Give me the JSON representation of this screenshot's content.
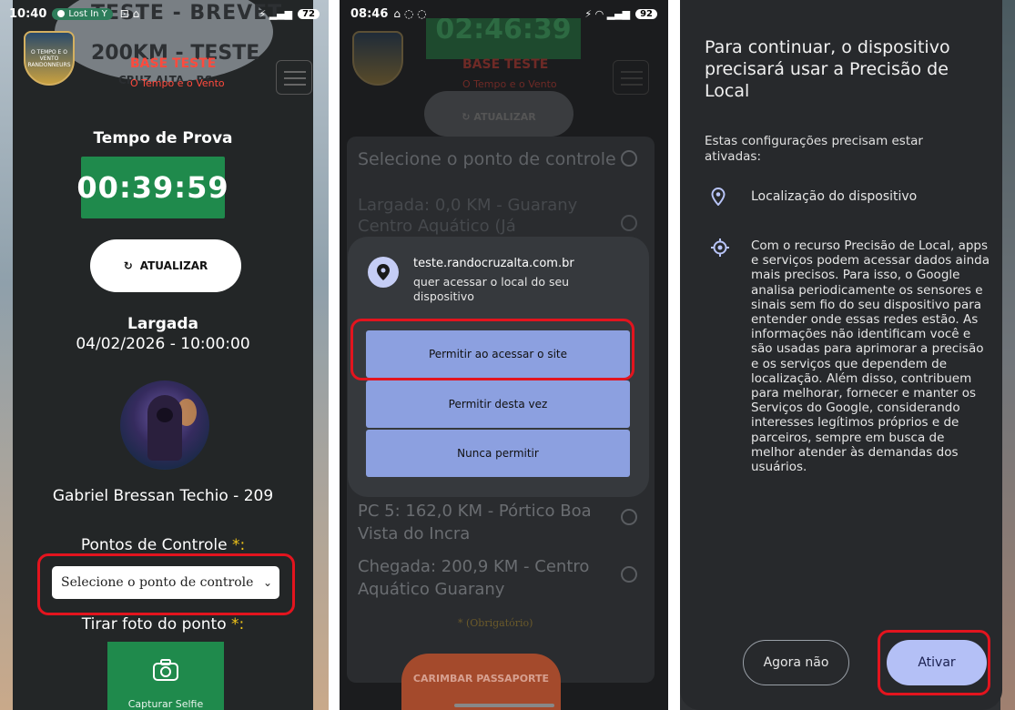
{
  "phone1": {
    "status": {
      "time": "10:40",
      "media": "Lost In Y",
      "battery": "72"
    },
    "header": {
      "ghost_line1": "TESTE - BREVET",
      "ghost_line2": "200KM - TESTE",
      "ghost_line3": "CRUZ ALTA - RS",
      "base_title": "BASE TESTE",
      "base_sub": "O Tempo e o Vento",
      "logo_text": "O TEMPO E O VENTO RANDONNEURS"
    },
    "tempo_label": "Tempo de Prova",
    "timer": "00:39:59",
    "refresh_label": "ATUALIZAR",
    "largada_title": "Largada",
    "largada_datetime": "04/02/2026 - 10:00:00",
    "rider_name": "Gabriel Bressan Techio - 209",
    "controle_label": "Pontos de Controle",
    "required_mark": "*:",
    "select_value": "Selecione o ponto de controle",
    "foto_label": "Tirar foto do ponto",
    "foto_button": "Capturar Selfie"
  },
  "phone2": {
    "status": {
      "time": "08:46",
      "battery": "92"
    },
    "bg": {
      "timer_ghost": "02:46:39",
      "base_title": "BASE TESTE",
      "base_sub": "O Tempo e o Vento",
      "refresh": "ATUALIZAR",
      "select_heading": "Selecione o ponto de controle",
      "opt_largada": "Largada: 0,0 KM - Guarany Centro Aquático (Já",
      "opt_pc5": "PC 5: 162,0 KM - Pórtico Boa Vista do Incra",
      "opt_chegada": "Chegada: 200,9 KM - Centro Aquático Guarany",
      "obrigatorio": "* (Obrigatório)",
      "carimbar": "CARIMBAR PASSAPORTE"
    },
    "dialog": {
      "site": "teste.randocruzalta.com.br",
      "message": "quer acessar o local do seu dispositivo",
      "btn_site": "Permitir ao acessar o site",
      "btn_once": "Permitir desta vez",
      "btn_never": "Nunca permitir"
    }
  },
  "phone3": {
    "title": "Para continuar, o dispositivo precisará usar a Precisão de Local",
    "subtitle": "Estas configurações precisam estar ativadas:",
    "item1": "Localização do dispositivo",
    "item2": "Com o recurso Precisão de Local, apps e serviços podem acessar dados ainda mais precisos. Para isso, o Google analisa periodicamente os sensores e sinais sem fio do seu dispositivo para entender onde essas redes estão. As informações não identificam você e são usadas para aprimorar a precisão e os serviços que dependem de localização. Além disso, contribuem para melhorar, fornecer e manter os Serviços do Google, considerando interesses legítimos próprios e de parceiros, sempre em busca de melhor atender às demandas dos usuários.",
    "btn_no": "Agora não",
    "btn_yes": "Ativar"
  },
  "colors": {
    "highlight": "#e3141e",
    "timer_green": "#1f8a4c",
    "accent_red": "#ff4a3d",
    "dialog_button": "#8ca0e0",
    "activate_button": "#b4c0f6"
  }
}
